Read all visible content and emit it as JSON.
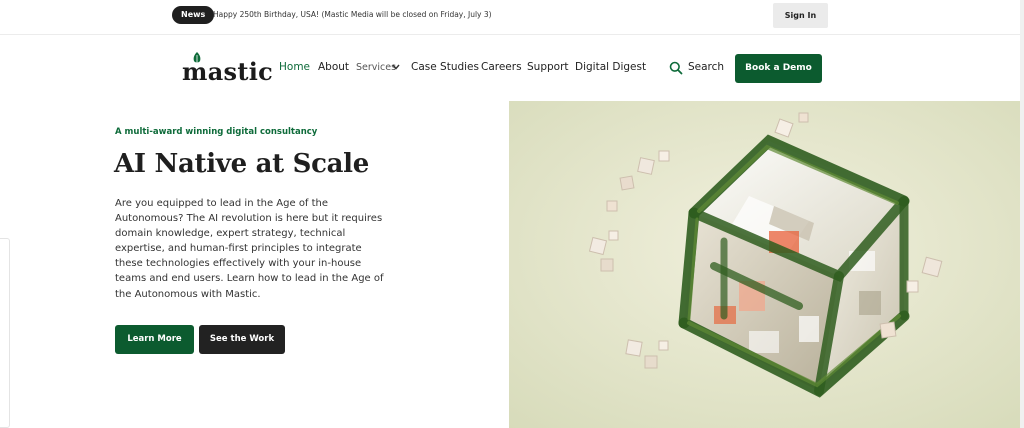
{
  "topbar": {
    "news_label": "News",
    "announcement": "Happy 250th Birthday, USA! (Mastic Media will be closed on Friday, July 3)",
    "signin_label": "Sign In"
  },
  "nav": {
    "logo_text": "mastic",
    "items": [
      {
        "label": "Home"
      },
      {
        "label": "About"
      },
      {
        "label": "Services"
      },
      {
        "label": "Case Studies"
      },
      {
        "label": "Careers"
      },
      {
        "label": "Support"
      },
      {
        "label": "Digital Digest"
      }
    ],
    "search_label": "Search",
    "demo_label": "Book a Demo"
  },
  "hero": {
    "eyebrow": "A multi-award winning digital consultancy",
    "title": "AI Native at Scale",
    "body": "Are you equipped to lead in the Age of the Autonomous? The AI revolution is here but it requires domain knowledge, expert strategy, technical expertise, and human-first principles to integrate these technologies effectively with your in-house teams and end users. Learn how to lead in the Age of the Autonomous with Mastic.",
    "learn_more_label": "Learn More",
    "see_work_label": "See the Work"
  },
  "colors": {
    "brand_green": "#0c5b2f",
    "accent_green": "#0e6b3a",
    "dark_button": "#222222"
  }
}
